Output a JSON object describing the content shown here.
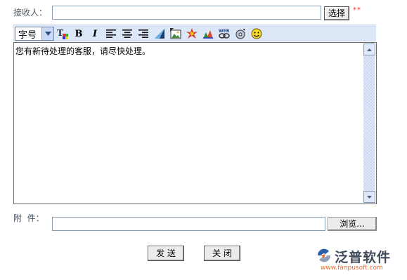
{
  "recipient": {
    "label": "接收人：",
    "value": "",
    "select_button": "选择",
    "required_mark": "**"
  },
  "toolbar": {
    "font_size_select": "字号",
    "icons": [
      "font-color-icon",
      "bold-icon",
      "italic-icon",
      "align-left-icon",
      "align-center-icon",
      "align-right-icon",
      "edit-icon",
      "insert-image-icon",
      "flash-icon",
      "insert-object-icon",
      "hyperlink-icon",
      "media-icon",
      "emoticon-icon"
    ],
    "bold_glyph": "B",
    "italic_glyph": "I"
  },
  "editor": {
    "content": "您有新待处理的客服，请尽快处理。"
  },
  "attachment": {
    "label": "附  件：",
    "value": "",
    "browse_button": "浏览..."
  },
  "actions": {
    "send": "发 送",
    "close": "关 闭"
  },
  "brand": {
    "name": "泛普软件",
    "url": "www.fanpusoft.com"
  }
}
